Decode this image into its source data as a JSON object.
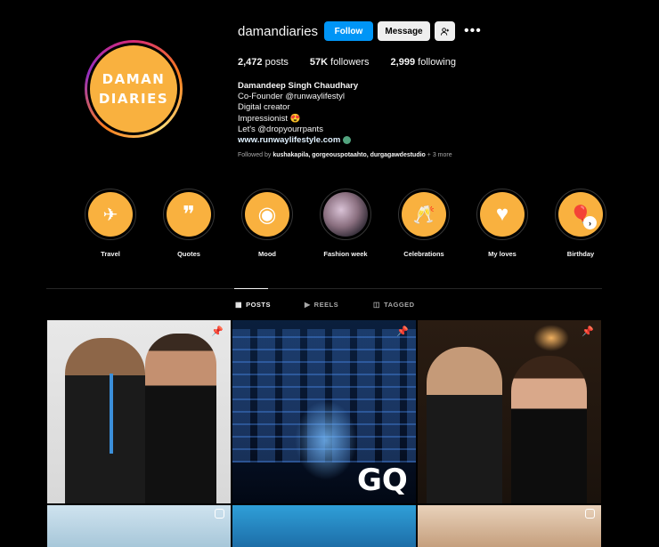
{
  "profile": {
    "username": "damandiaries",
    "avatar_text_line1": "DAMAN",
    "avatar_text_line2": "DIARIES",
    "follow_label": "Follow",
    "message_label": "Message",
    "stats": {
      "posts_count": "2,472",
      "posts_label": "posts",
      "followers_count": "57K",
      "followers_label": "followers",
      "following_count": "2,999",
      "following_label": "following"
    },
    "bio": {
      "name": "Damandeep Singh Chaudhary",
      "line1": "Co-Founder @runwaylifestyl",
      "line2": "Digital creator",
      "line3": "Impressionist 😍",
      "line4": "Let's @dropyourrpants",
      "link": "www.runwaylifestyle.com"
    },
    "followed_by_prefix": "Followed by",
    "followed_by_users": "kushakapila, gorgeouspotaahto, durgagawdestudio",
    "followed_by_more": "+ 3 more"
  },
  "highlights": [
    {
      "label": "Travel",
      "icon": "airplane-icon",
      "glyph": "✈"
    },
    {
      "label": "Quotes",
      "icon": "quote-icon",
      "glyph": "❞"
    },
    {
      "label": "Mood",
      "icon": "vinyl-icon",
      "glyph": "◉"
    },
    {
      "label": "Fashion week",
      "icon": "photo-icon",
      "glyph": ""
    },
    {
      "label": "Celebrations",
      "icon": "champagne-icon",
      "glyph": "🥂"
    },
    {
      "label": "My loves",
      "icon": "heart-icon",
      "glyph": "♥"
    },
    {
      "label": "Birthday",
      "icon": "balloon-icon",
      "glyph": "🎈"
    }
  ],
  "tabs": {
    "posts": "POSTS",
    "reels": "REELS",
    "tagged": "TAGGED"
  },
  "colors": {
    "accent": "#0095f6",
    "highlight_bg": "#f9b13f",
    "background": "#000000"
  }
}
